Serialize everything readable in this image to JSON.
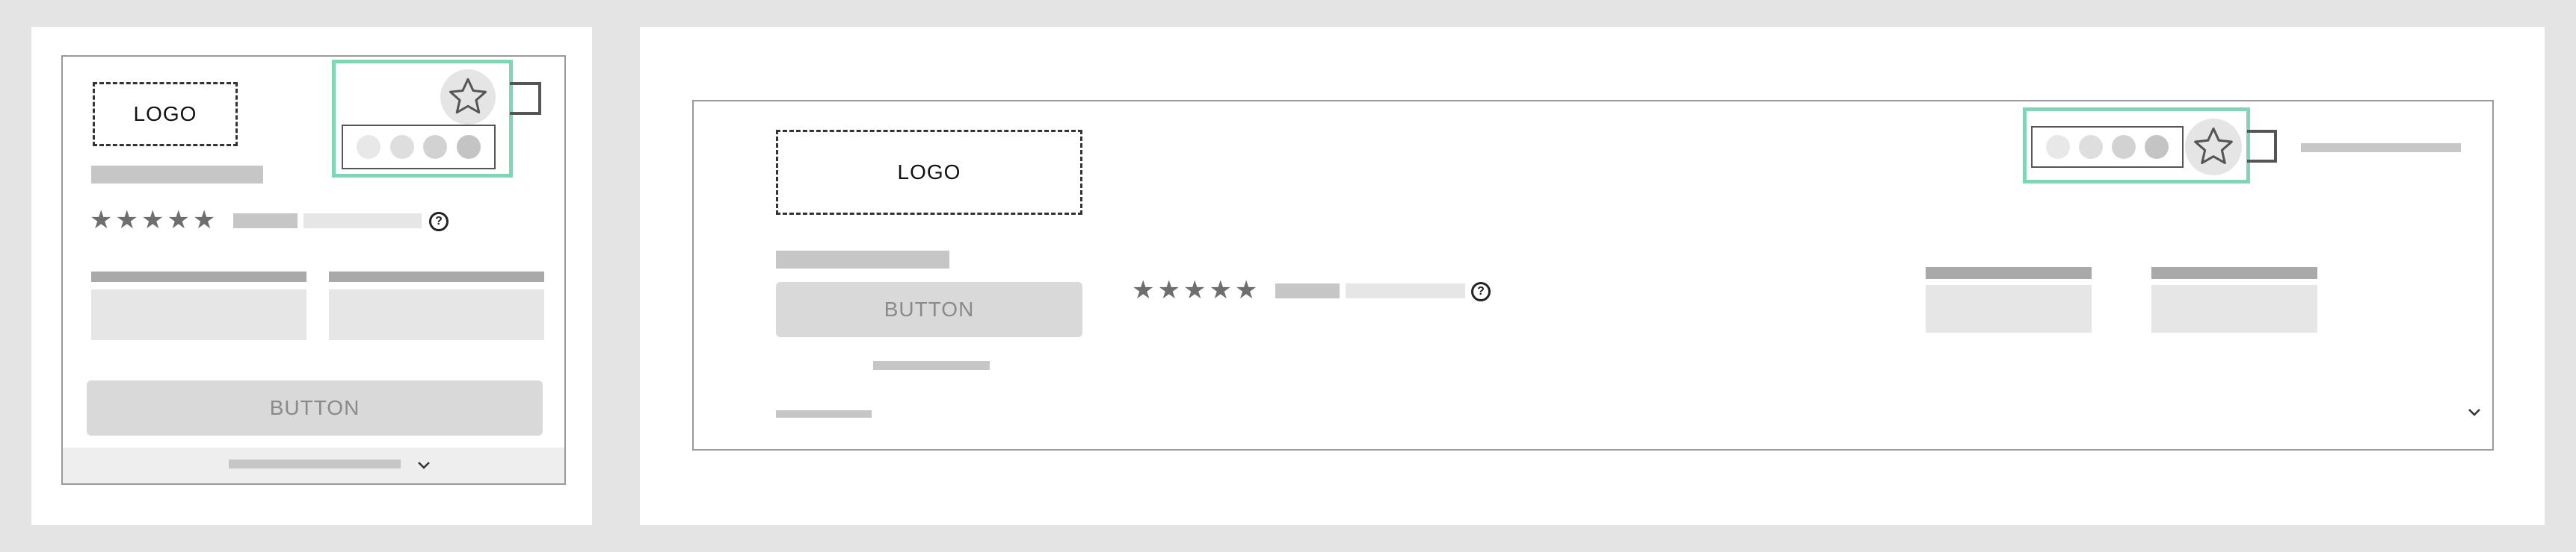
{
  "mobile": {
    "logo": "LOGO",
    "button": "BUTTON",
    "help_symbol": "?",
    "stars": "★★★★★",
    "chevron_icon": "chevron-down-icon",
    "star_icon": "star-outline-icon"
  },
  "desktop": {
    "logo": "LOGO",
    "button": "BUTTON",
    "help_symbol": "?",
    "stars": "★★★★★",
    "chevron_icon": "chevron-down-icon",
    "star_icon": "star-outline-icon"
  },
  "colors": {
    "highlight": "#7ed6b5",
    "placeholder_mid": "#c6c6c6",
    "placeholder_light": "#e6e6e6",
    "background": "#e4e4e4"
  }
}
